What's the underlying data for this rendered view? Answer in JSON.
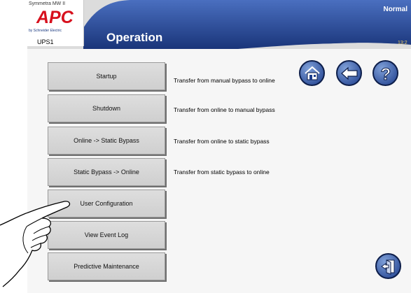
{
  "header": {
    "product_name": "Symmetra MW II",
    "logo_text": "APC",
    "brand_text": "by Schneider Electric",
    "unit_name": "UPS1",
    "page_title": "Operation",
    "status_text": "Normal",
    "clock_text": "13:2"
  },
  "menu": [
    {
      "label": "Startup",
      "description": "Transfer from manual bypass to online"
    },
    {
      "label": "Shutdown",
      "description": "Transfer from online to manual bypass"
    },
    {
      "label": "Online -> Static Bypass",
      "description": "Transfer from online to static bypass"
    },
    {
      "label": "Static Bypass -> Online",
      "description": "Transfer from static bypass to online"
    },
    {
      "label": "User Configuration",
      "description": ""
    },
    {
      "label": "View Event Log",
      "description": ""
    },
    {
      "label": "Predictive Maintenance",
      "description": ""
    }
  ],
  "nav_icons": [
    "home-icon",
    "back-arrow-icon",
    "help-icon",
    "logout-door-icon"
  ],
  "colors": {
    "header_blue": "#1e3f8a",
    "header_gray": "#dcdcdc",
    "logo_red": "#d7101d",
    "button_face": "#d6d6d6"
  }
}
